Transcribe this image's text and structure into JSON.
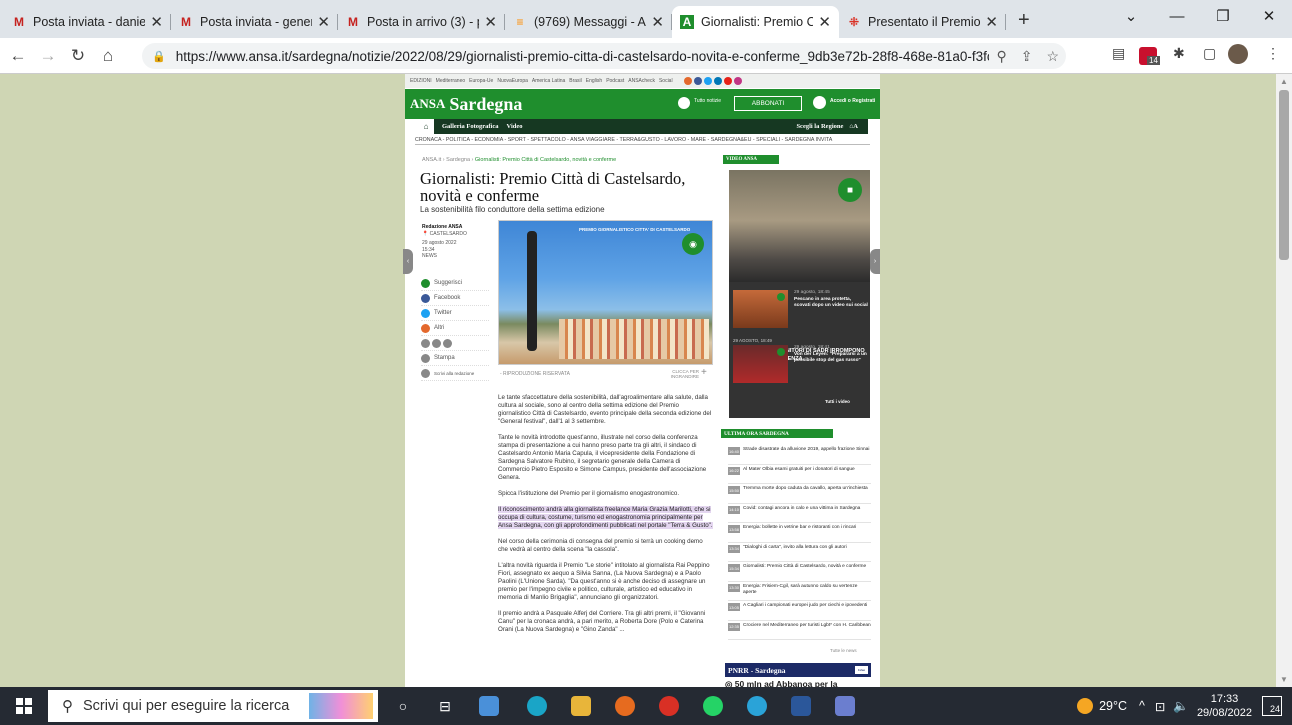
{
  "browser": {
    "tabs": [
      {
        "title": "Posta inviata - daniela",
        "icon": "gmail-icon",
        "active": false
      },
      {
        "title": "Posta inviata - genera",
        "icon": "gmail-icon",
        "active": false
      },
      {
        "title": "Posta in arrivo (3) - pr",
        "icon": "gmail-icon",
        "active": false
      },
      {
        "title": "(9769) Messaggi - Ar",
        "icon": "aruba-icon",
        "active": false
      },
      {
        "title": "Giornalisti: Premio Citt",
        "icon": "ansa-icon",
        "active": true
      },
      {
        "title": "Presentato il Premio C",
        "icon": "grid-icon",
        "active": false
      }
    ],
    "url": "https://www.ansa.it/sardegna/notizie/2022/08/29/giornalisti-premio-citta-di-castelsardo-novita-e-conferme_9db3e72b-28f8-468e-81a0-f3fcb...",
    "ext_badge": "14"
  },
  "site": {
    "top_strip": [
      "EDIZIONI",
      "Mediterraneo",
      "Europa-Ue",
      "NuovaEuropa",
      "America Latina",
      "Brasil",
      "English",
      "Podcast",
      "ANSAcheck",
      "Social"
    ],
    "logo_ansa": "ANSA",
    "logo_region": "Sardegna",
    "search_label": "Tutto notizie",
    "abbonati": "ABBONATI",
    "accedi": "Accedi o Registrati",
    "subnav": [
      "Galleria Fotografica",
      "Video"
    ],
    "scegli": "Scegli la Regione",
    "sections": "CRONACA - POLITICA - ECONOMIA - SPORT - SPETTACOLO - ANSA VIAGGIARE - TERRA&GUSTO - LAVORO - MARE - SARDEGNA&EU - SPECIALI - SARDEGNA INVITA",
    "breadcrumb": {
      "home": "ANSA.it",
      "section": "Sardegna",
      "current": "Giornalisti: Premio Città di Castelsardo, novità e conferme"
    },
    "title": "Giornalisti: Premio Città di Castelsardo, novità e conferme",
    "subtitle": "La sostenibilità filo conduttore della settima edizione",
    "meta": {
      "author": "Redazione ANSA",
      "place": "CASTELSARDO",
      "date": "29 agosto 2022",
      "time": "15:34",
      "type": "NEWS"
    },
    "share": [
      "Suggerisci",
      "Facebook",
      "Twitter",
      "Altri",
      "Stampa",
      "Scrivi alla redazione"
    ],
    "photo_title": "PREMIO GIORNALISTICO CITTA' DI CASTELSARDO",
    "photo_caption": "- RIPRODUZIONE RISERVATA",
    "photo_enlarge": "CLICCA PER INGRANDIRE",
    "paragraphs": [
      "Le tante sfaccettature della sostenibilità, dall'agroalimentare alla salute, dalla cultura al sociale, sono al centro della settima edizione del Premio giornalistico Città di Castelsardo, evento principale della seconda edizione del \"General festival\", dall'1 al 3 settembre.",
      "Tante le novità introdotte quest'anno, illustrate nel corso della conferenza stampa di presentazione a cui hanno preso parte tra gli altri, il sindaco di Castelsardo Antonio Maria Capula, il vicepresidente della Fondazione di Sardegna Salvatore Rubino, il segretario generale della Camera di Commercio Pietro Esposito e Simone Campus, presidente dell'associazione Genera.",
      "Spicca l'istituzione del Premio per il giornalismo enogastronomico."
    ],
    "highlight": "Il riconoscimento andrà alla giornalista freelance Maria Grazia Marilotti, che si occupa di cultura, costume, turismo ed enogastronomia principalmente per Ansa Sardegna, con gli approfondimenti pubblicati nel portale \"Terra & Gusto\".",
    "paragraphs2": [
      "Nel corso della cerimonia di consegna del premio si terrà un cooking demo che vedrà al centro della scena \"la cassola\".",
      "L'altra novità riguarda il Premio \"Le storie\" intitolato al giornalista Rai Peppino Fiori, assegnato ex aequo a Silvia Sanna, (La Nuova Sardegna) e a Paolo Paolini (L'Unione Sarda). \"Da quest'anno si è anche deciso di assegnare un premio per l'impegno civile e politico, culturale, artistico ed educativo in memoria di Manlio Brigaglia\", annunciano gli organizzatori.",
      "Il premio andrà a Pasquale Alferj del Corriere. Tra gli altri premi, il \"Giovanni Canu\" per la cronaca andrà, a pari merito, a Roberta Dore (Polo e Caterina Orani (La Nuova Sardegna) e \"Gino Zanda\" ..."
    ],
    "video": {
      "header": "VIDEO ANSA",
      "main_date": "29 AGOSTO, 18:49",
      "main_title": "BAGHDAD, I SOSTENITORI DI SADR IRROMPONO IN PALAZZO PRESIDENZA",
      "items": [
        {
          "date": "29 agosto, 18:45",
          "title": "Pescano in area protetta, scovati dopo un video sui social"
        },
        {
          "date": "29 agosto, 18:41",
          "title": "Von der Leyen: \"Prepararsi a un possibile stop del gas russo\""
        }
      ],
      "all": "Tutti i video"
    },
    "ultima": {
      "header": "ULTIMA ORA SARDEGNA",
      "items": [
        {
          "time": "16:40",
          "text": "Strade disastrate da alluvione 2019, appello frazione Sinnai"
        },
        {
          "time": "16:22",
          "text": "Al Mater Olbia esami gratuiti per i donatori di sangue"
        },
        {
          "time": "15:50",
          "text": "Tremma morte dopo caduta da cavallo, aperta un'inchiesta"
        },
        {
          "time": "14:10",
          "text": "Covid: contagi ancora in calo e una vittima in Sardegna"
        },
        {
          "time": "13:58",
          "text": "Energia: bollette in vetrine bar e ristoranti con i rincari"
        },
        {
          "time": "13:34",
          "text": "\"Dialoghi di carta\", invito alla lettura con gli autori"
        },
        {
          "time": "15:34",
          "text": "Giornalisti: Premio Città di Castelsardo, novità e conferme"
        },
        {
          "time": "13:30",
          "text": "Energia: Frisiem-Cgil, sarà autunno caldo su vertenze aperte"
        },
        {
          "time": "13:05",
          "text": "A Cagliari i campionati europei judo per ciechi e ipovedenti"
        },
        {
          "time": "12:35",
          "text": "Crociere nel Mediterraneo per turisti Lgbt* con H. Caribbean"
        }
      ],
      "all": "Tutte le news"
    },
    "pnrr": {
      "title": "PNRR - Sardegna",
      "live": "Live",
      "teaser": "50 mln ad Abbanoa per la"
    }
  },
  "taskbar": {
    "search_placeholder": "Scrivi qui per eseguire la ricerca",
    "weather": "29°C",
    "time": "17:33",
    "date": "29/08/2022",
    "notifications": "24"
  }
}
